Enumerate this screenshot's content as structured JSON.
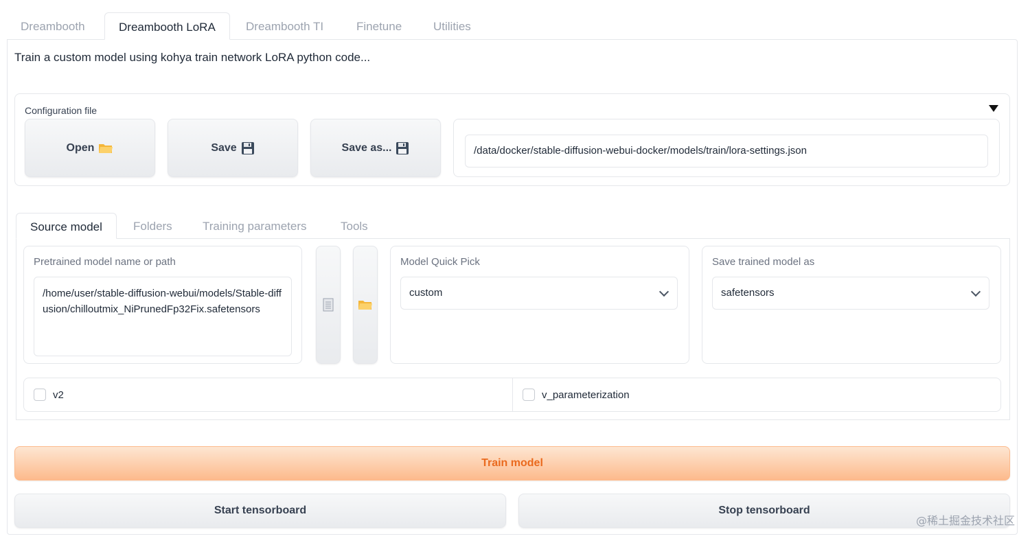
{
  "top_tabs": [
    {
      "label": "Dreambooth"
    },
    {
      "label": "Dreambooth LoRA"
    },
    {
      "label": "Dreambooth TI"
    },
    {
      "label": "Finetune"
    },
    {
      "label": "Utilities"
    }
  ],
  "description": "Train a custom model using kohya train network LoRA python code...",
  "config": {
    "label": "Configuration file",
    "open_label": "Open",
    "save_label": "Save",
    "save_as_label": "Save as...",
    "path_value": "/data/docker/stable-diffusion-webui-docker/models/train/lora-settings.json"
  },
  "sub_tabs": [
    {
      "label": "Source model"
    },
    {
      "label": "Folders"
    },
    {
      "label": "Training parameters"
    },
    {
      "label": "Tools"
    }
  ],
  "source_model": {
    "pretrained_label": "Pretrained model name or path",
    "pretrained_value": "/home/user/stable-diffusion-webui/models/Stable-diffusion/chilloutmix_NiPrunedFp32Fix.safetensors",
    "quick_pick_label": "Model Quick Pick",
    "quick_pick_value": "custom",
    "save_as_label": "Save trained model as",
    "save_as_value": "safetensors",
    "v2_label": "v2",
    "v_param_label": "v_parameterization"
  },
  "actions": {
    "train_label": "Train model",
    "start_tb_label": "Start tensorboard",
    "stop_tb_label": "Stop tensorboard"
  },
  "watermark": "@稀土掘金技术社区",
  "colors": {
    "accent": "#ea6a1e",
    "train_bg": "#fdba8c"
  },
  "icons": {
    "open": "folder-icon",
    "save": "floppy-disk-icon",
    "file": "document-icon",
    "folder": "folder-icon"
  }
}
